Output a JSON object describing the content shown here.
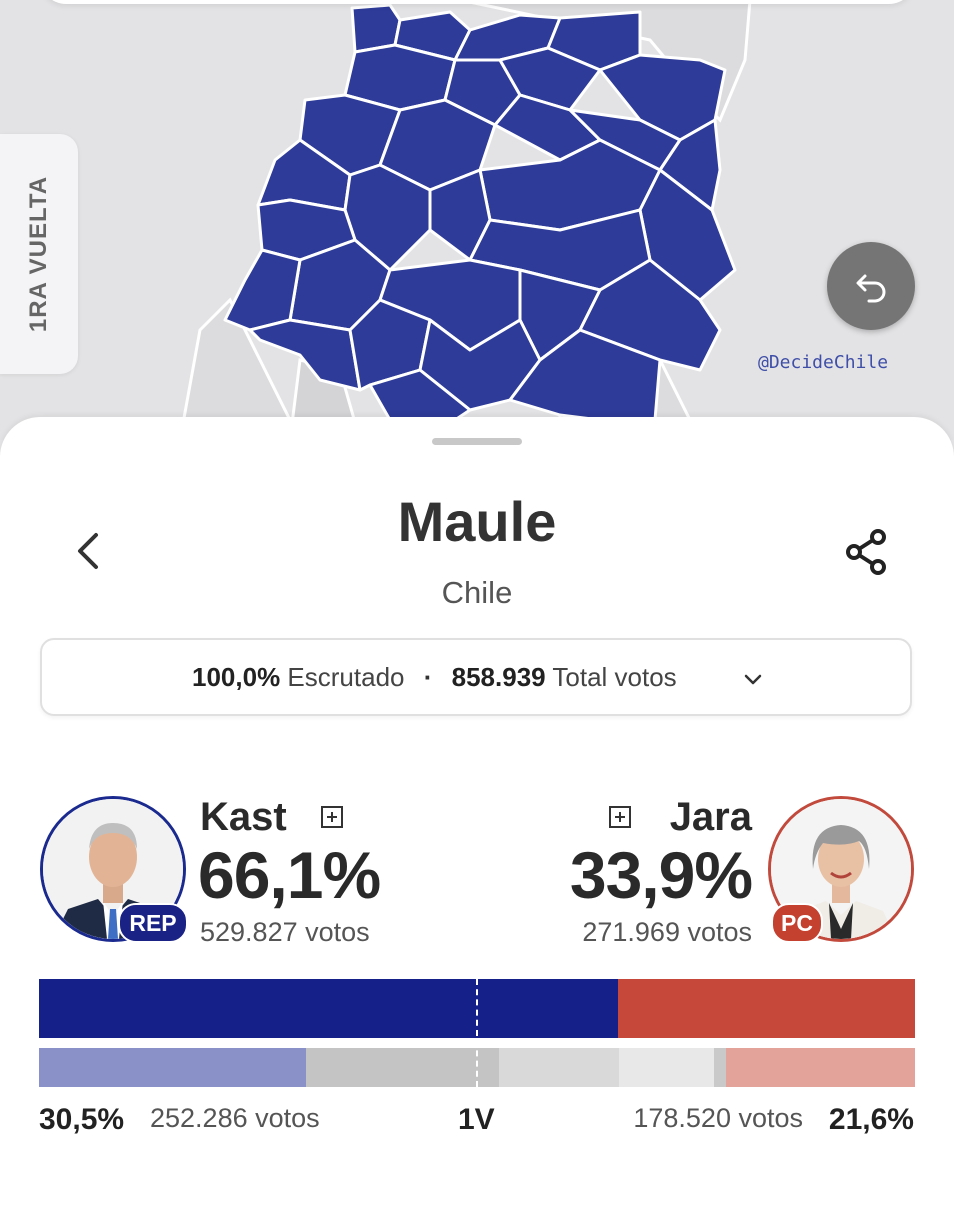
{
  "map": {
    "round_tab_label": "1RA VUELTA",
    "credit": "@DecideChile",
    "region_fill_color": "#2e3b98",
    "inactive_region_color": "#dcdcde"
  },
  "header": {
    "region": "Maule",
    "country": "Chile"
  },
  "summary": {
    "scrutinized_pct": "100,0%",
    "scrutinized_label": "Escrutado",
    "separator": "·",
    "total_votes": "858.939",
    "total_votes_label": "Total votos"
  },
  "candidates": {
    "left": {
      "name": "Kast",
      "party": "REP",
      "pct": "66,1%",
      "votes": "529.827 votos",
      "share": 0.661,
      "color": "#152188"
    },
    "right": {
      "name": "Jara",
      "party": "PC",
      "pct": "33,9%",
      "votes": "271.969 votos",
      "share": 0.339,
      "color": "#c5483b"
    }
  },
  "first_round": {
    "label": "1V",
    "left_pct": "30,5%",
    "left_votes": "252.286 votos",
    "right_pct": "21,6%",
    "right_votes": "178.520 votos",
    "segments": [
      {
        "share": 0.305,
        "color": "#8a90c8"
      },
      {
        "share": 0.22,
        "color": "#c4c4c4"
      },
      {
        "share": 0.137,
        "color": "#d9d9d9"
      },
      {
        "share": 0.108,
        "color": "#e8e8e8"
      },
      {
        "share": 0.014,
        "color": "#c9c9c9"
      },
      {
        "share": 0.216,
        "color": "#e3a29a"
      }
    ]
  },
  "colors": {
    "accent": "#2e3b98",
    "left_party": "#152188",
    "right_party": "#c5483b"
  }
}
